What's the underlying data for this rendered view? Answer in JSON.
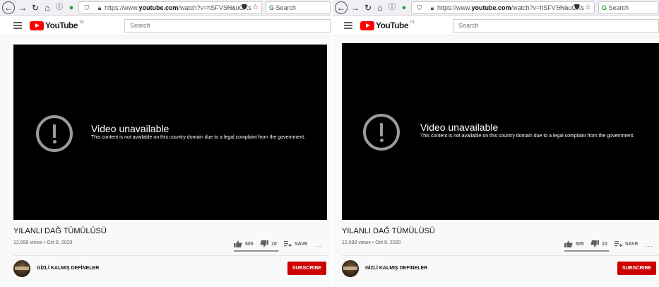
{
  "browser": {
    "url_prefix": "https://www.",
    "url_domain": "youtube.com",
    "url_path": "/watch?v=hSFVSNauGXs",
    "search_placeholder": "Search",
    "page_actions": "···"
  },
  "youtube": {
    "logo_text": "YouTube",
    "logo_suffix": "TR",
    "search_placeholder": "Search"
  },
  "player": {
    "unavailable_title": "Video unavailable",
    "unavailable_message": "This content is not available on this country domain due to a legal complaint from the government."
  },
  "video": {
    "title": "YILANLI DAĞ TÜMÜLÜSÜ",
    "views": "12,698 views",
    "date": "Oct 9, 2020",
    "meta_separator": "•",
    "likes": "505",
    "dislikes": "10",
    "save_label": "SAVE",
    "more": "...",
    "like_ratio": 0.98
  },
  "channel": {
    "name": "GİZLİ KALMIŞ DEFİNELER",
    "subscribe_label": "SUBSCRIBE"
  },
  "colors": {
    "subscribe": "#cc0000",
    "logo_red": "#ff0000",
    "player_bg": "#000000"
  }
}
